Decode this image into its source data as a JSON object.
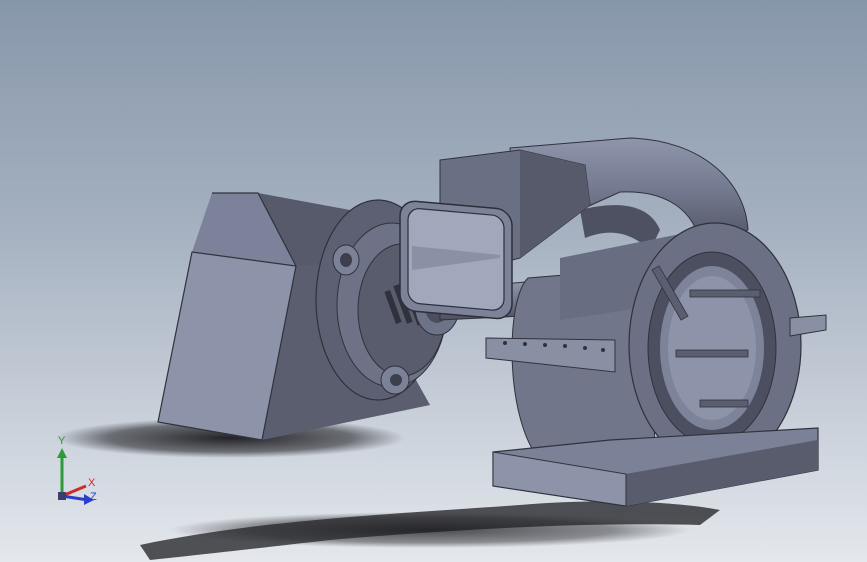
{
  "viewport": {
    "background_top": "#8797aa",
    "background_bottom": "#e4e8ed"
  },
  "model": {
    "body_color": "#5d6172",
    "body_highlight": "#8a90a6",
    "body_shadow": "#3e4150"
  },
  "triad": {
    "x_label": "X",
    "y_label": "Y",
    "z_label": "Z",
    "x_color": "#cc2b2b",
    "y_color": "#2e9a3a",
    "z_color": "#2b3fcc"
  }
}
